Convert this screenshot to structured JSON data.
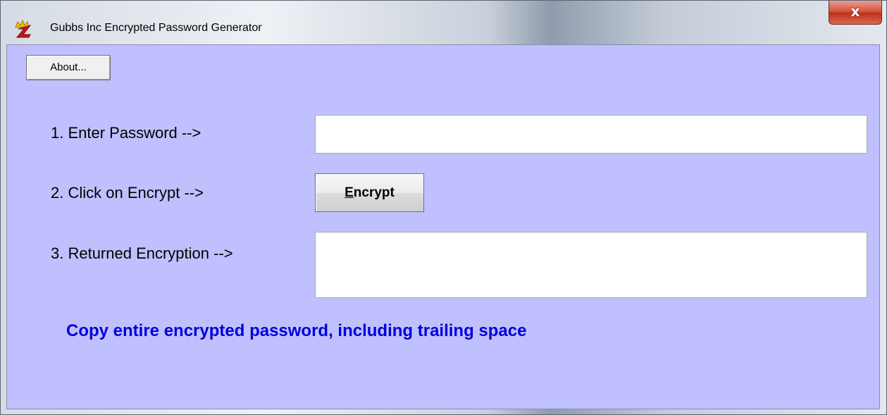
{
  "window": {
    "title": "Gubbs Inc Encrypted Password Generator",
    "close_label": "x"
  },
  "toolbar": {
    "about_label": "About..."
  },
  "form": {
    "step1_label": "1. Enter Password -->",
    "password_value": "",
    "step2_label": "2. Click on Encrypt -->",
    "encrypt_label_mnemonic": "E",
    "encrypt_label_rest": "ncrypt",
    "step3_label": "3. Returned Encryption -->",
    "result_value": ""
  },
  "hint": {
    "text": "Copy entire encrypted password, including trailing space"
  },
  "colors": {
    "client_background": "#c0c0ff",
    "hint_text": "#0000dd",
    "close_button": "#c0301c"
  },
  "icons": {
    "app_icon": "app-logo-icon",
    "close_icon": "close-icon"
  }
}
